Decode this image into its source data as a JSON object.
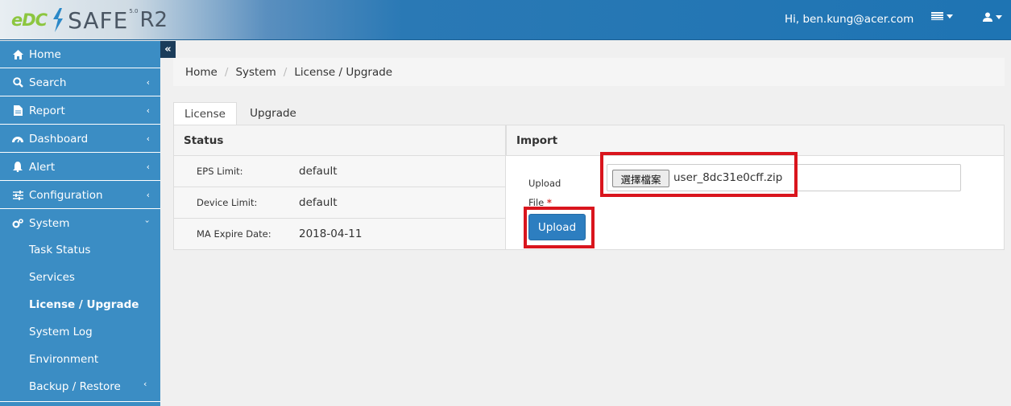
{
  "header": {
    "logo_brand": "eDC",
    "logo_product": "SAFE",
    "logo_version": "5.0",
    "logo_suffix": "R2",
    "greeting": "Hi, ben.kung@acer.com",
    "icons": [
      "flag-icon",
      "user-icon"
    ]
  },
  "sidebar": {
    "items": [
      {
        "label": "Home",
        "icon": "home-icon"
      },
      {
        "label": "Search",
        "icon": "search-icon"
      },
      {
        "label": "Report",
        "icon": "file-icon"
      },
      {
        "label": "Dashboard",
        "icon": "dashboard-icon"
      },
      {
        "label": "Alert",
        "icon": "bell-icon"
      },
      {
        "label": "Configuration",
        "icon": "sliders-icon"
      },
      {
        "label": "System",
        "icon": "gears-icon"
      }
    ],
    "system_sub": [
      {
        "label": "Task Status"
      },
      {
        "label": "Services"
      },
      {
        "label": "License / Upgrade",
        "active": true
      },
      {
        "label": "System Log"
      },
      {
        "label": "Environment"
      },
      {
        "label": "Backup / Restore"
      }
    ]
  },
  "breadcrumb": [
    "Home",
    "System",
    "License / Upgrade"
  ],
  "tabs": [
    "License",
    "Upgrade"
  ],
  "status_panel": {
    "title": "Status",
    "rows": [
      {
        "label": "EPS Limit:",
        "value": "default"
      },
      {
        "label": "Device Limit:",
        "value": "default"
      },
      {
        "label": "MA Expire Date:",
        "value": "2018-04-11"
      }
    ]
  },
  "import_panel": {
    "title": "Import",
    "upload_label": "Upload",
    "file_label": "File",
    "required_mark": "*",
    "choose_file_button": "選擇檔案",
    "file_name": "user_8dc31e0cff.zip",
    "upload_button": "Upload"
  },
  "colors": {
    "sidebar": "#3b8dc4",
    "header": "#1e74b3",
    "primary_button": "#2d7ec0",
    "highlight": "#d9151d"
  }
}
